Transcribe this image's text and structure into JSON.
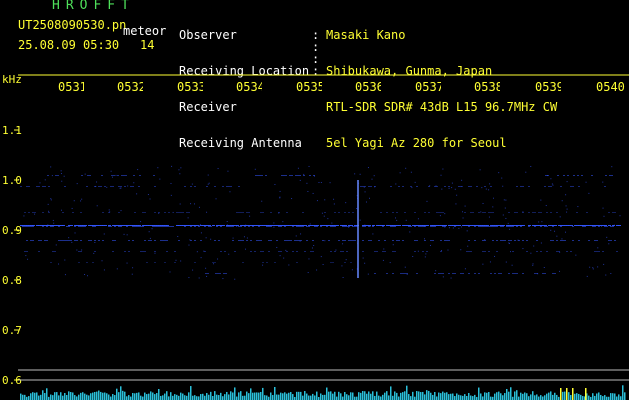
{
  "header": {
    "app_title": "HROFFT",
    "file_name": "UT2508090530.pn",
    "meteor_label": "meteor",
    "datetime": "25.08.09 05:30",
    "count": "14",
    "info": [
      {
        "label": "Observer",
        "value": "Masaki Kano"
      },
      {
        "label": "Receiving Location",
        "value": "Shibukawa, Gunma, Japan"
      },
      {
        "label": "Receiver",
        "value": "RTL-SDR SDR# 43dB L15 96.7MHz CW"
      },
      {
        "label": "Receiving Antenna",
        "value": "5el Yagi Az 280 for Seoul"
      }
    ]
  },
  "axis": {
    "unit": "kHz",
    "y_ticks": [
      "1.1",
      "1.0",
      "0.9",
      "0.8",
      "0.7",
      "0.6"
    ],
    "time_ticks": [
      "0531",
      "0532",
      "0533",
      "0534",
      "0535",
      "0536",
      "0537",
      "0538",
      "0539",
      "0540"
    ]
  },
  "colors": {
    "label_yellow": "#ffff33",
    "title_green": "#4ee05a",
    "signal_blue": "#3355ff",
    "spectrum_cyan": "#33e0ff"
  }
}
